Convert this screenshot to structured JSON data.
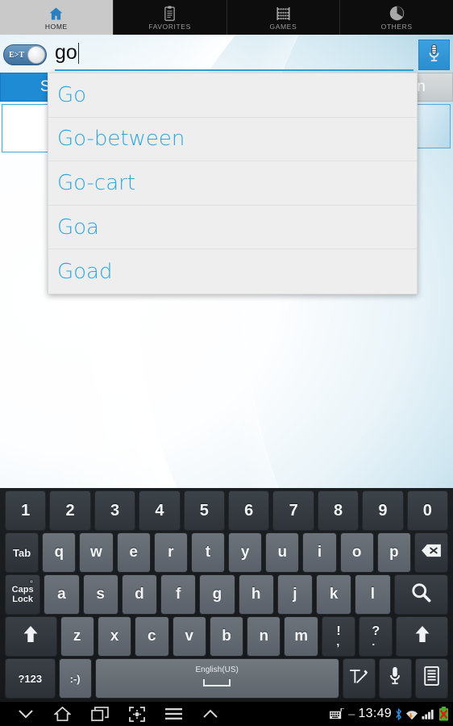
{
  "tabs": [
    {
      "label": "HOME",
      "icon": "home-icon",
      "active": true
    },
    {
      "label": "FAVORITES",
      "icon": "clipboard-icon",
      "active": false
    },
    {
      "label": "GAMES",
      "icon": "abacus-icon",
      "active": false
    },
    {
      "label": "OTHERS",
      "icon": "pie-icon",
      "active": false
    }
  ],
  "search": {
    "direction_toggle": "E>T",
    "query": "go",
    "mic_icon": "microphone-icon"
  },
  "controls": {
    "search_button": "Search",
    "clean_button": "Clean"
  },
  "suggestions": [
    "Go",
    "Go-between",
    "Go-cart",
    "Goa",
    "Goad"
  ],
  "keyboard": {
    "row_numbers": [
      "1",
      "2",
      "3",
      "4",
      "5",
      "6",
      "7",
      "8",
      "9",
      "0"
    ],
    "row_q": [
      "q",
      "w",
      "e",
      "r",
      "t",
      "y",
      "u",
      "i",
      "o",
      "p"
    ],
    "row_a": [
      "a",
      "s",
      "d",
      "f",
      "g",
      "h",
      "j",
      "k",
      "l"
    ],
    "row_z": [
      "z",
      "x",
      "c",
      "v",
      "b",
      "n",
      "m"
    ],
    "tab_key": "Tab",
    "backspace_key": "backspace-icon",
    "caps_key_line1": "Caps",
    "caps_key_line2": "Lock",
    "search_key": "search-icon",
    "shift_key": "shift-icon",
    "punct1_top": "!",
    "punct1_bottom": ",",
    "punct2_top": "?",
    "punct2_bottom": ".",
    "sym_key": "?123",
    "emoji_key": ":-)",
    "space_label": "English(US)",
    "handwriting_key": "handwriting-icon",
    "voice_key": "microphone-icon",
    "clipboard_key": "clipboard-icon"
  },
  "navbar": {
    "back": "chevron-down-icon",
    "home": "home-outline-icon",
    "recents": "recents-icon",
    "screenshot": "screen-capture-icon",
    "menu": "menu-icon",
    "expand": "chevron-up-icon",
    "keyboard_status": "keyboard-icon",
    "dash": "–",
    "clock": "13:49",
    "bluetooth": "bluetooth-icon",
    "wifi": "wifi-icon",
    "signal": "signal-icon",
    "battery": "battery-error-icon"
  },
  "colors": {
    "accent_blue": "#2aa7e3",
    "button_blue": "#1e8bd4",
    "tab_active_bg": "#c9c9c9",
    "tabbar_bg": "#0d0d0d",
    "dropdown_bg": "#efeeee"
  }
}
